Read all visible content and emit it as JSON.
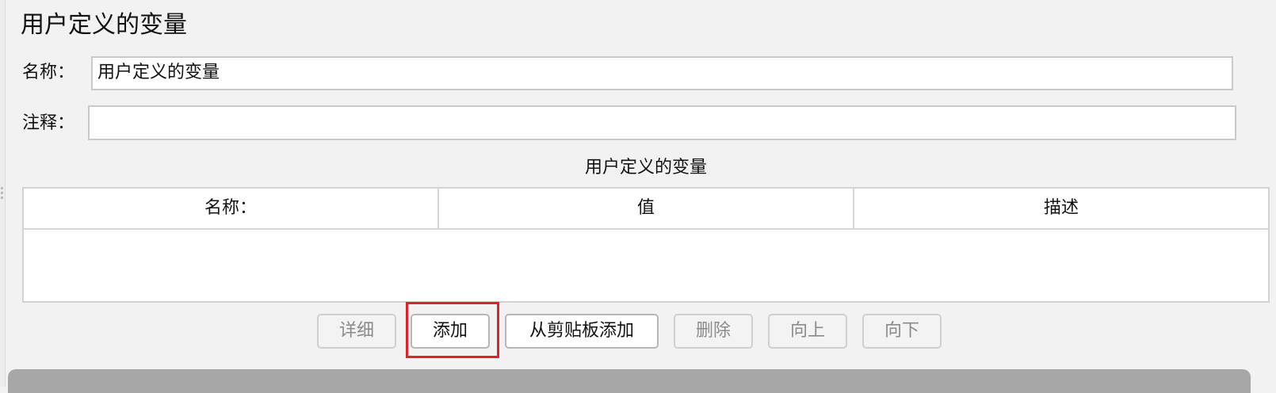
{
  "page": {
    "title": "用户定义的变量"
  },
  "form": {
    "name_label": "名称：",
    "name_value": "用户定义的变量",
    "comment_label": "注释：",
    "comment_value": ""
  },
  "table": {
    "caption": "用户定义的变量",
    "columns": [
      "名称：",
      "值",
      "描述"
    ],
    "rows": []
  },
  "buttons": {
    "detail": "详细",
    "add": "添加",
    "add_from_clipboard": "从剪贴板添加",
    "delete": "删除",
    "up": "向上",
    "down": "向下"
  },
  "colors": {
    "highlight": "#e0202a",
    "disabled_text": "#8a8a8a",
    "panel_bg": "#f2f2f2"
  }
}
